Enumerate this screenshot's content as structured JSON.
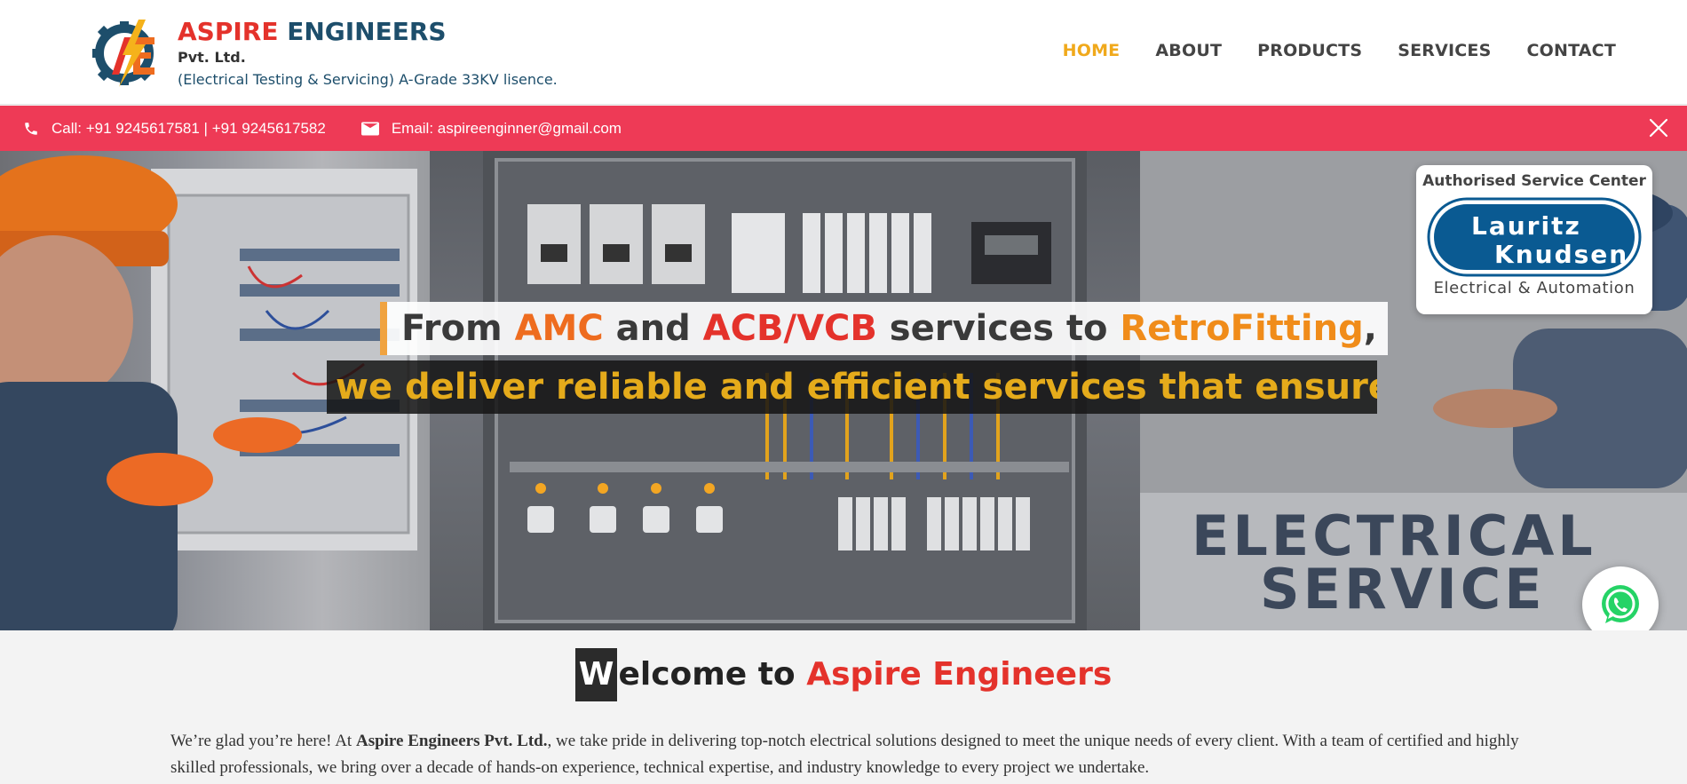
{
  "brand": {
    "name_part1": "ASPIRE",
    "name_part2": "ENGINEERS",
    "sub": "Pvt. Ltd.",
    "tagline": "(Electrical Testing & Servicing) A-Grade 33KV lisence.",
    "logo_letters": "AE"
  },
  "nav": {
    "items": [
      {
        "label": "HOME",
        "active": true
      },
      {
        "label": "ABOUT"
      },
      {
        "label": "PRODUCTS"
      },
      {
        "label": "SERVICES"
      },
      {
        "label": "CONTACT"
      }
    ]
  },
  "topbar": {
    "call_text": "Call: +91 9245617581 | +91 9245617582",
    "email_text": "Email: aspireenginner@gmail.com",
    "phone_icon": "phone-icon",
    "email_icon": "mail-icon",
    "close_icon": "close-icon",
    "bg_color": "#ee3a56"
  },
  "hero": {
    "line1_parts": [
      "From ",
      "AMC",
      " and ",
      "ACB/VCB",
      " services to ",
      "RetroFitting",
      ","
    ],
    "line2": "we deliver reliable and efficient services that ensure op",
    "background_text_1": "ELECTRICAL",
    "background_text_2": "SERVICE"
  },
  "auth_card": {
    "title": "Authorised Service Center",
    "logo_line1": "Lauritz",
    "logo_line2": "Knudsen",
    "subtitle": "Electrical & Automation"
  },
  "whatsapp": {
    "icon": "whatsapp-icon"
  },
  "welcome": {
    "cap_letter": "W",
    "title_rest": "elcome to ",
    "title_highlight": "Aspire Engineers",
    "body_before": "We’re glad you’re here! At ",
    "body_bold": "Aspire Engineers Pvt. Ltd.",
    "body_after": ", we take pride in delivering top-notch electrical solutions designed to meet the unique needs of every client. With a team of certified and highly skilled professionals, we bring over a decade of hands-on experience, technical expertise, and industry knowledge to every project we undertake."
  },
  "colors": {
    "brand_red": "#e4322b",
    "brand_blue": "#1d4e6b",
    "nav_active": "#f0a91c",
    "headline_gold": "#e5ab1b",
    "lk_blue": "#0a5a92"
  }
}
